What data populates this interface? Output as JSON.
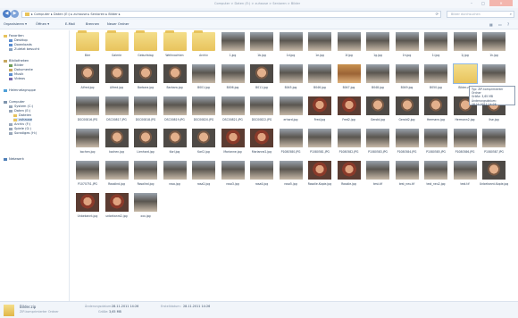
{
  "window": {
    "title": "Computer > Daten (E:) > zuhause > Senioren > Bilder"
  },
  "address": {
    "crumbs": "▸ Computer ▸ Daten (E:) ▸ zuhause ▸ Senioren ▸ Bilder ▸",
    "search_placeholder": "Bilder durchsuchen"
  },
  "toolbar": {
    "organize": "Organisieren ▾",
    "open": "Öffnen ▾",
    "print": "E-Mail",
    "burn": "Brennen",
    "new_folder": "Neuer Ordner"
  },
  "sidebar": {
    "favorites": "Favoriten",
    "desktop": "Desktop",
    "downloads": "Downloads",
    "recent": "Zuletzt besucht",
    "libraries": "Bibliotheken",
    "pictures": "Bilder",
    "documents": "Dokumente",
    "music": "Musik",
    "videos": "Videos",
    "homegroup": "Heimnetzgruppe",
    "computer": "Computer",
    "drive_c": "System (C:)",
    "drive_e": "Daten (E:)",
    "dateien": "Dateien",
    "zuhause": "zuhause",
    "drive_f": "Archiv (F:)",
    "drive_g": "Spiele (G:)",
    "drive_h": "Sonstiges (H:)",
    "network": "Netzwerk"
  },
  "files": [
    {
      "label": "Bier",
      "kind": "folder"
    },
    {
      "label": "Galerie",
      "kind": "folder"
    },
    {
      "label": "Geburtstag",
      "kind": "folder"
    },
    {
      "label": "Weihnachten",
      "kind": "folder"
    },
    {
      "label": "Archiv",
      "kind": "folder"
    },
    {
      "label": "1.jpg",
      "kind": "group"
    },
    {
      "label": "1b.jpg",
      "kind": "group"
    },
    {
      "label": "1d.jpg",
      "kind": "group"
    },
    {
      "label": "1e.jpg",
      "kind": "group"
    },
    {
      "label": "1f.jpg",
      "kind": "group"
    },
    {
      "label": "1g.jpg",
      "kind": "group"
    },
    {
      "label": "1h.jpg",
      "kind": "group"
    },
    {
      "label": "1i.jpg",
      "kind": "group"
    },
    {
      "label": "1j.jpg",
      "kind": "group"
    },
    {
      "label": "1k.jpg",
      "kind": "group"
    },
    {
      "label": "Alfred.jpg",
      "kind": "face"
    },
    {
      "label": "Alfred.jpg",
      "kind": "face"
    },
    {
      "label": "Barbara.jpg",
      "kind": "face"
    },
    {
      "label": "Barbara.jpg",
      "kind": "face"
    },
    {
      "label": "B001.jpg",
      "kind": "group"
    },
    {
      "label": "B006.jpg",
      "kind": "group"
    },
    {
      "label": "B011.jpg",
      "kind": "face"
    },
    {
      "label": "B045.jpg",
      "kind": "group"
    },
    {
      "label": "B046.jpg",
      "kind": "group"
    },
    {
      "label": "B047.jpg",
      "kind": "warm"
    },
    {
      "label": "B048.jpg",
      "kind": "group"
    },
    {
      "label": "B049.jpg",
      "kind": "group"
    },
    {
      "label": "B050.jpg",
      "kind": "group"
    },
    {
      "label": "Bilder.zip",
      "kind": "selected"
    },
    {
      "label": "DSC00815.JPG",
      "kind": "group"
    },
    {
      "label": "DSC00816.JPG",
      "kind": "group"
    },
    {
      "label": "DSC00817.JPG",
      "kind": "group"
    },
    {
      "label": "DSC00818.JPG",
      "kind": "group"
    },
    {
      "label": "DSC00819.JPG",
      "kind": "group"
    },
    {
      "label": "DSC00820.JPG",
      "kind": "group"
    },
    {
      "label": "DSC00821.JPG",
      "kind": "group"
    },
    {
      "label": "DSC00822.JPG",
      "kind": "group"
    },
    {
      "label": "erhard.jpg",
      "kind": "group"
    },
    {
      "label": "Fred.jpg",
      "kind": "red"
    },
    {
      "label": "Fred2.jpg",
      "kind": "red"
    },
    {
      "label": "Gerold.jpg",
      "kind": "face"
    },
    {
      "label": "Gerold2.jpg",
      "kind": "face"
    },
    {
      "label": "Hermann.jpg",
      "kind": "face"
    },
    {
      "label": "Hermann2.jpg",
      "kind": "face"
    },
    {
      "label": "Ilse.jpg",
      "kind": "face"
    },
    {
      "label": "kochen.jpg",
      "kind": "group"
    },
    {
      "label": "kochen.jpg",
      "kind": "face"
    },
    {
      "label": "Lienhard.jpg",
      "kind": "face"
    },
    {
      "label": "Karl.jpg",
      "kind": "face"
    },
    {
      "label": "Karl2.jpg",
      "kind": "face"
    },
    {
      "label": "Marianne.jpg",
      "kind": "red"
    },
    {
      "label": "Marianne2.jpg",
      "kind": "red"
    },
    {
      "label": "P1080580.JPG",
      "kind": "group"
    },
    {
      "label": "P1080581.JPG",
      "kind": "group"
    },
    {
      "label": "P1080582.JPG",
      "kind": "group"
    },
    {
      "label": "P1080583.JPG",
      "kind": "group"
    },
    {
      "label": "P1080584.JPG",
      "kind": "group"
    },
    {
      "label": "P1080585.JPG",
      "kind": "group"
    },
    {
      "label": "P1080586.JPG",
      "kind": "group"
    },
    {
      "label": "P1080587.JPG",
      "kind": "group"
    },
    {
      "label": "P1070751.JPG",
      "kind": "group"
    },
    {
      "label": "Rosalind.jpg",
      "kind": "group"
    },
    {
      "label": "Rosalind.jpg",
      "kind": "group"
    },
    {
      "label": "rosa.jpg",
      "kind": "group"
    },
    {
      "label": "rosa2.jpg",
      "kind": "group"
    },
    {
      "label": "rosa3.jpg",
      "kind": "group"
    },
    {
      "label": "rosa4.jpg",
      "kind": "group"
    },
    {
      "label": "rosa5.jpg",
      "kind": "group"
    },
    {
      "label": "Rosalie-Kopie.jpg",
      "kind": "red"
    },
    {
      "label": "Rosalie.jpg",
      "kind": "red"
    },
    {
      "label": "test.tif",
      "kind": "group"
    },
    {
      "label": "test_neu.tif",
      "kind": "group"
    },
    {
      "label": "test_neu2.jpg",
      "kind": "group"
    },
    {
      "label": "test.tif",
      "kind": "group"
    },
    {
      "label": "Unbekannt-Kopie.jpg",
      "kind": "face"
    },
    {
      "label": "Unbekannt.jpg",
      "kind": "red"
    },
    {
      "label": "unbekannt2.jpg",
      "kind": "red"
    },
    {
      "label": "xxx.jpg",
      "kind": "group"
    }
  ],
  "tooltip": {
    "line1": "Typ: ZIP-komprimierter Ordner",
    "line2": "Größe: 3,65 MB",
    "line3": "Änderungsdatum: 28.11.2011 14:26"
  },
  "status": {
    "name": "Bilder.zip",
    "type": "ZIP-komprimierter Ordner",
    "modified_label": "Änderungsdatum:",
    "modified_value": "28.11.2011 14:26",
    "size_label": "Größe:",
    "size_value": "3,65 MB",
    "created_label": "Erstelldatum:",
    "created_value": "28.11.2011 14:26"
  }
}
